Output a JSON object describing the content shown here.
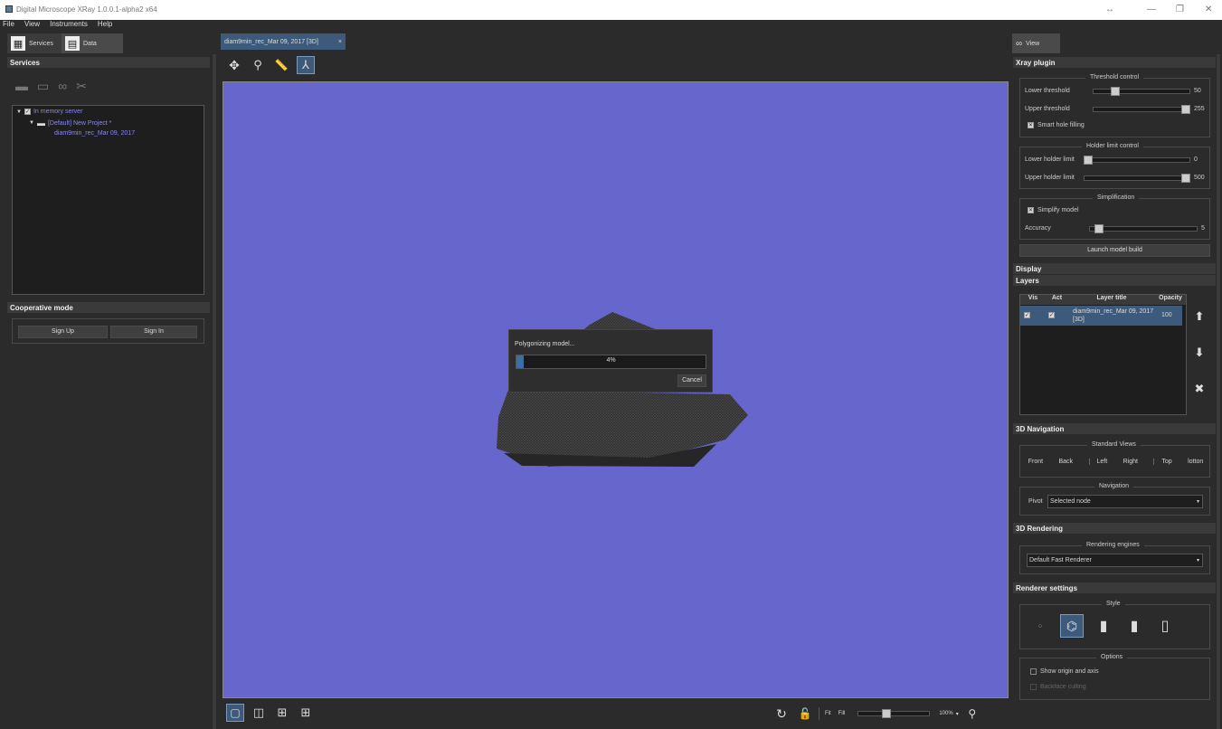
{
  "window": {
    "title": "Digital Microscope XRay 1.0.0.1-alpha2 x64",
    "resize_glyph": "↔",
    "min_glyph": "—",
    "max_glyph": "❐",
    "close_glyph": "✕"
  },
  "menu": [
    "File",
    "View",
    "Instruments",
    "Help"
  ],
  "left_tabs": [
    {
      "label": "Services",
      "icon": "grid-icon"
    },
    {
      "label": "Data",
      "icon": "stack-icon"
    }
  ],
  "services": {
    "header": "Services",
    "tree": {
      "server": "In memory server",
      "project": "[Default] New Project *",
      "dataset": "diam9min_rec_Mar 09, 2017"
    }
  },
  "cooperative": {
    "header": "Cooperative mode",
    "sign_up": "Sign Up",
    "sign_in": "Sign In"
  },
  "doc_tab": {
    "label": "diam9min_rec_Mar 09, 2017 [3D]",
    "close": "×"
  },
  "progress": {
    "title": "Polygonizing model...",
    "percent_text": "4%",
    "value": 0.04,
    "cancel": "Cancel"
  },
  "right_tab": {
    "label": "View"
  },
  "xray": {
    "header": "Xray plugin",
    "threshold": {
      "title": "Threshold control",
      "lower_label": "Lower threshold",
      "lower_value": "50",
      "upper_label": "Upper threshold",
      "upper_value": "255",
      "smart": "Smart hole filling",
      "lower_frac": 0.2,
      "upper_frac": 1.0
    },
    "holder": {
      "title": "Holder limit control",
      "lower_label": "Lower holder limit",
      "lower_value": "0",
      "upper_label": "Upper holder limit",
      "upper_value": "500",
      "lower_frac": 0.0,
      "upper_frac": 1.0
    },
    "simplification": {
      "title": "Simplification",
      "simplify": "Simplify model",
      "accuracy_label": "Accuracy",
      "accuracy_value": "5",
      "accuracy_frac": 0.05
    },
    "launch": "Launch model build"
  },
  "display_header": "Display",
  "layers": {
    "header": "Layers",
    "columns": [
      "Vis",
      "Act",
      "Layer title",
      "Opacity"
    ],
    "rows": [
      {
        "title": "diam9min_rec_Mar 09, 2017 [3D]",
        "opacity": "100"
      }
    ]
  },
  "nav3d": {
    "header": "3D Navigation",
    "std_title": "Standard Views",
    "views": [
      "Front",
      "Back",
      "Left",
      "Right",
      "Top",
      "lotton"
    ],
    "nav_title": "Navigation",
    "pivot_label": "Pivot",
    "pivot_value": "Selected node"
  },
  "render3d": {
    "header": "3D Rendering",
    "engines_title": "Rendering engines",
    "engine_value": "Default Fast Renderer"
  },
  "renderer_settings": {
    "header": "Renderer settings",
    "style_title": "Style",
    "options_title": "Options",
    "show_origin": "Show origin and axis",
    "backface": "Backface culling"
  },
  "bottom": {
    "fit": "Fit",
    "fill": "Fill",
    "zoom": "100%",
    "zoom_frac": 0.38
  }
}
